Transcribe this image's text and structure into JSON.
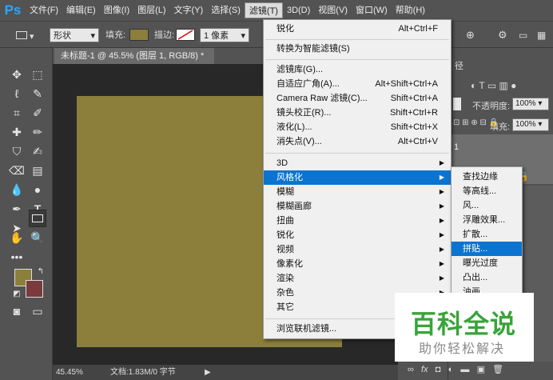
{
  "menubar": {
    "logo": "Ps",
    "items": [
      "文件(F)",
      "编辑(E)",
      "图像(I)",
      "图层(L)",
      "文字(Y)",
      "选择(S)",
      "滤镜(T)",
      "3D(D)",
      "视图(V)",
      "窗口(W)",
      "帮助(H)"
    ],
    "active": "滤镜(T)"
  },
  "options": {
    "shape_mode": "形状",
    "fill_label": "填充:",
    "stroke_label": "描边:",
    "stroke_width": "1 像素",
    "fill_color": "#8b7f3b"
  },
  "document": {
    "tab_title": "未标题-1 @ 45.5% (图层 1, RGB/8) *",
    "zoom": "45.45%",
    "doc_info": "文档:1.83M/0 字节",
    "canvas_color": "#8b7f3b"
  },
  "panels": {
    "opacity_label": "不透明度:",
    "opacity_value": "100%",
    "fill_label": "填充:",
    "fill_value": "100%",
    "tab_fragment": "径",
    "layer_number": "1"
  },
  "filter_menu": {
    "group1": [
      {
        "label": "锐化",
        "shortcut": "Alt+Ctrl+F"
      }
    ],
    "group2": [
      {
        "label": "转换为智能滤镜(S)",
        "shortcut": ""
      }
    ],
    "group3": [
      {
        "label": "滤镜库(G)...",
        "shortcut": ""
      },
      {
        "label": "自适应广角(A)...",
        "shortcut": "Alt+Shift+Ctrl+A"
      },
      {
        "label": "Camera Raw 滤镜(C)...",
        "shortcut": "Shift+Ctrl+A"
      },
      {
        "label": "镜头校正(R)...",
        "shortcut": "Shift+Ctrl+R"
      },
      {
        "label": "液化(L)...",
        "shortcut": "Shift+Ctrl+X"
      },
      {
        "label": "消失点(V)...",
        "shortcut": "Alt+Ctrl+V"
      }
    ],
    "group4": [
      {
        "label": "3D"
      },
      {
        "label": "风格化"
      },
      {
        "label": "模糊"
      },
      {
        "label": "模糊画廊"
      },
      {
        "label": "扭曲"
      },
      {
        "label": "锐化"
      },
      {
        "label": "视频"
      },
      {
        "label": "像素化"
      },
      {
        "label": "渲染"
      },
      {
        "label": "杂色"
      },
      {
        "label": "其它"
      }
    ],
    "group5": [
      {
        "label": "浏览联机滤镜..."
      }
    ],
    "highlighted": "风格化"
  },
  "stylize_submenu": {
    "items": [
      "查找边缘",
      "等高线...",
      "风...",
      "浮雕效果...",
      "扩散...",
      "拼贴...",
      "曝光过度",
      "凸出...",
      "油画..."
    ],
    "highlighted": "拼贴..."
  },
  "watermark": {
    "title": "百科全说",
    "subtitle": "助你轻松解决"
  }
}
